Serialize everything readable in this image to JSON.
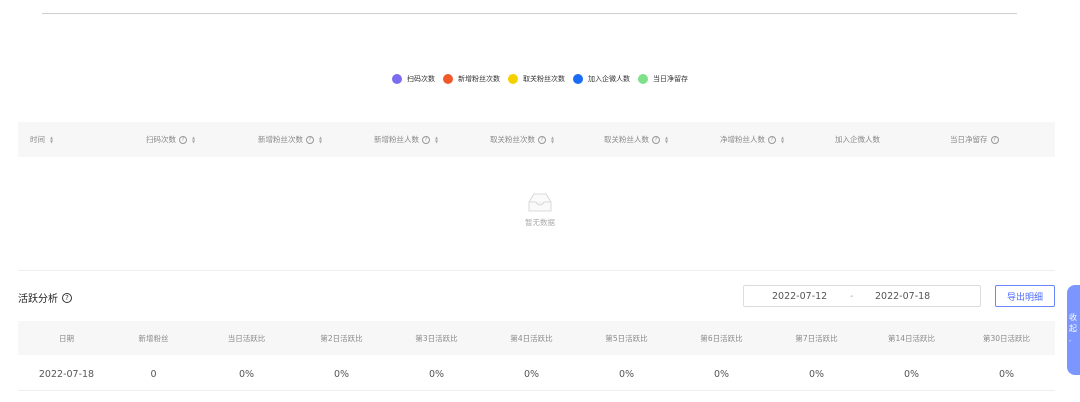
{
  "legend": [
    {
      "label": "扫码次数",
      "color": "#7b6cf0"
    },
    {
      "label": "新增粉丝次数",
      "color": "#f05a2a"
    },
    {
      "label": "取关粉丝次数",
      "color": "#f5d000"
    },
    {
      "label": "加入企微人数",
      "color": "#1a6cf5"
    },
    {
      "label": "当日净留存",
      "color": "#7fe08a"
    }
  ],
  "stats_table": {
    "headers": [
      {
        "label": "时间",
        "help": false,
        "sort": true
      },
      {
        "label": "扫码次数",
        "help": true,
        "sort": true
      },
      {
        "label": "新增粉丝次数",
        "help": true,
        "sort": true
      },
      {
        "label": "新增粉丝人数",
        "help": true,
        "sort": true
      },
      {
        "label": "取关粉丝次数",
        "help": true,
        "sort": true
      },
      {
        "label": "取关粉丝人数",
        "help": true,
        "sort": true
      },
      {
        "label": "净增粉丝人数",
        "help": true,
        "sort": true
      },
      {
        "label": "加入企微人数",
        "help": false,
        "sort": false
      },
      {
        "label": "当日净留存",
        "help": true,
        "sort": false
      }
    ],
    "empty_text": "暂无数据"
  },
  "activity": {
    "title": "活跃分析",
    "date_start": "2022-07-12",
    "date_sep": "-",
    "date_end": "2022-07-18",
    "export_label": "导出明细",
    "headers": [
      "日期",
      "新增粉丝",
      "当日活跃比",
      "第2日活跃比",
      "第3日活跃比",
      "第4日活跃比",
      "第5日活跃比",
      "第6日活跃比",
      "第7日活跃比",
      "第14日活跃比",
      "第30日活跃比"
    ],
    "rows": [
      [
        "2022-07-18",
        "0",
        "0%",
        "0%",
        "0%",
        "0%",
        "0%",
        "0%",
        "0%",
        "0%",
        "0%"
      ]
    ]
  },
  "collapse_tab": {
    "label1": "收",
    "label2": "起",
    "sub": "»"
  }
}
